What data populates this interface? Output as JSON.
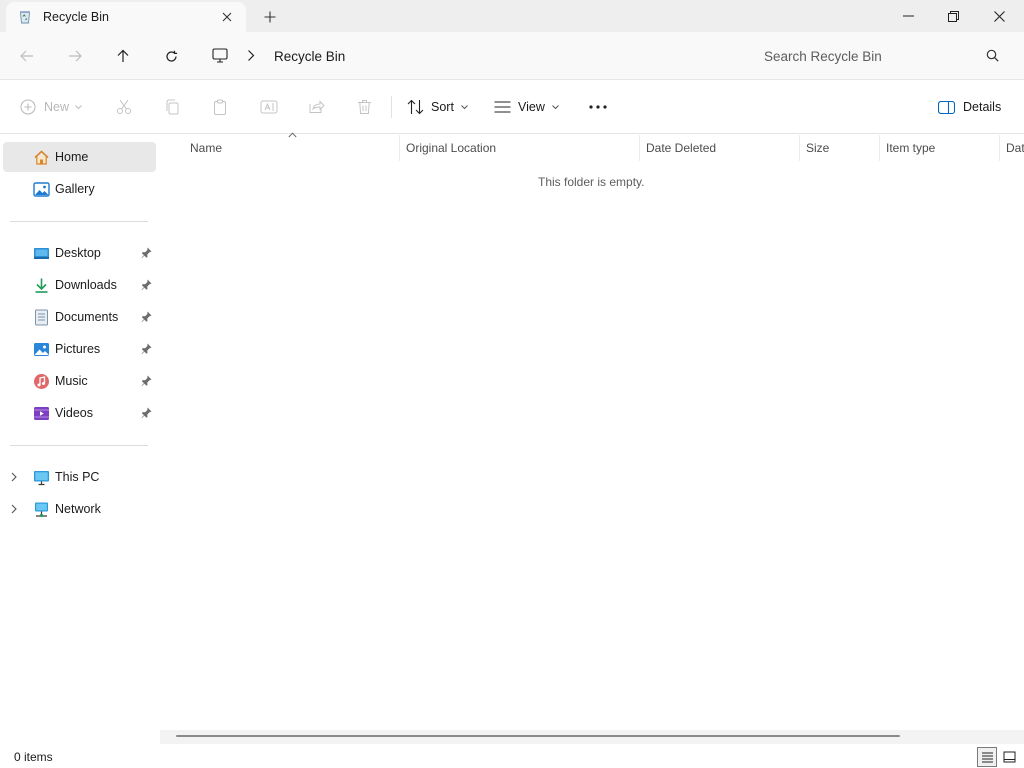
{
  "window": {
    "tab_title": "Recycle Bin",
    "tab_icon": "recycle-bin-icon",
    "controls": [
      "minimize",
      "restore",
      "close"
    ]
  },
  "navigation": {
    "breadcrumb": [
      "Recycle Bin"
    ],
    "root_icon": "this-pc-icon",
    "search_placeholder": "Search Recycle Bin"
  },
  "commands": {
    "new_label": "New",
    "sort_label": "Sort",
    "view_label": "View",
    "details_label": "Details",
    "more": "more-options-icon",
    "disabled_icons": [
      "cut-icon",
      "copy-icon",
      "paste-icon",
      "rename-icon",
      "share-icon",
      "delete-icon"
    ]
  },
  "sidebar": {
    "quick": [
      {
        "label": "Home",
        "icon": "home-icon",
        "selected": true
      },
      {
        "label": "Gallery",
        "icon": "gallery-icon"
      }
    ],
    "pinned": [
      {
        "label": "Desktop",
        "icon": "desktop-icon"
      },
      {
        "label": "Downloads",
        "icon": "downloads-icon"
      },
      {
        "label": "Documents",
        "icon": "documents-icon"
      },
      {
        "label": "Pictures",
        "icon": "pictures-icon"
      },
      {
        "label": "Music",
        "icon": "music-icon"
      },
      {
        "label": "Videos",
        "icon": "videos-icon"
      }
    ],
    "locations": [
      {
        "label": "This PC",
        "icon": "this-pc-icon"
      },
      {
        "label": "Network",
        "icon": "network-icon"
      }
    ]
  },
  "columns": [
    "Name",
    "Original Location",
    "Date Deleted",
    "Size",
    "Item type",
    "Dat"
  ],
  "empty_message": "This folder is empty.",
  "status": {
    "item_count": "0 items"
  },
  "colors": {
    "accent": "#0067c0",
    "selected_bg": "#e8e8e8",
    "titlebar_bg": "#eeeeee"
  }
}
